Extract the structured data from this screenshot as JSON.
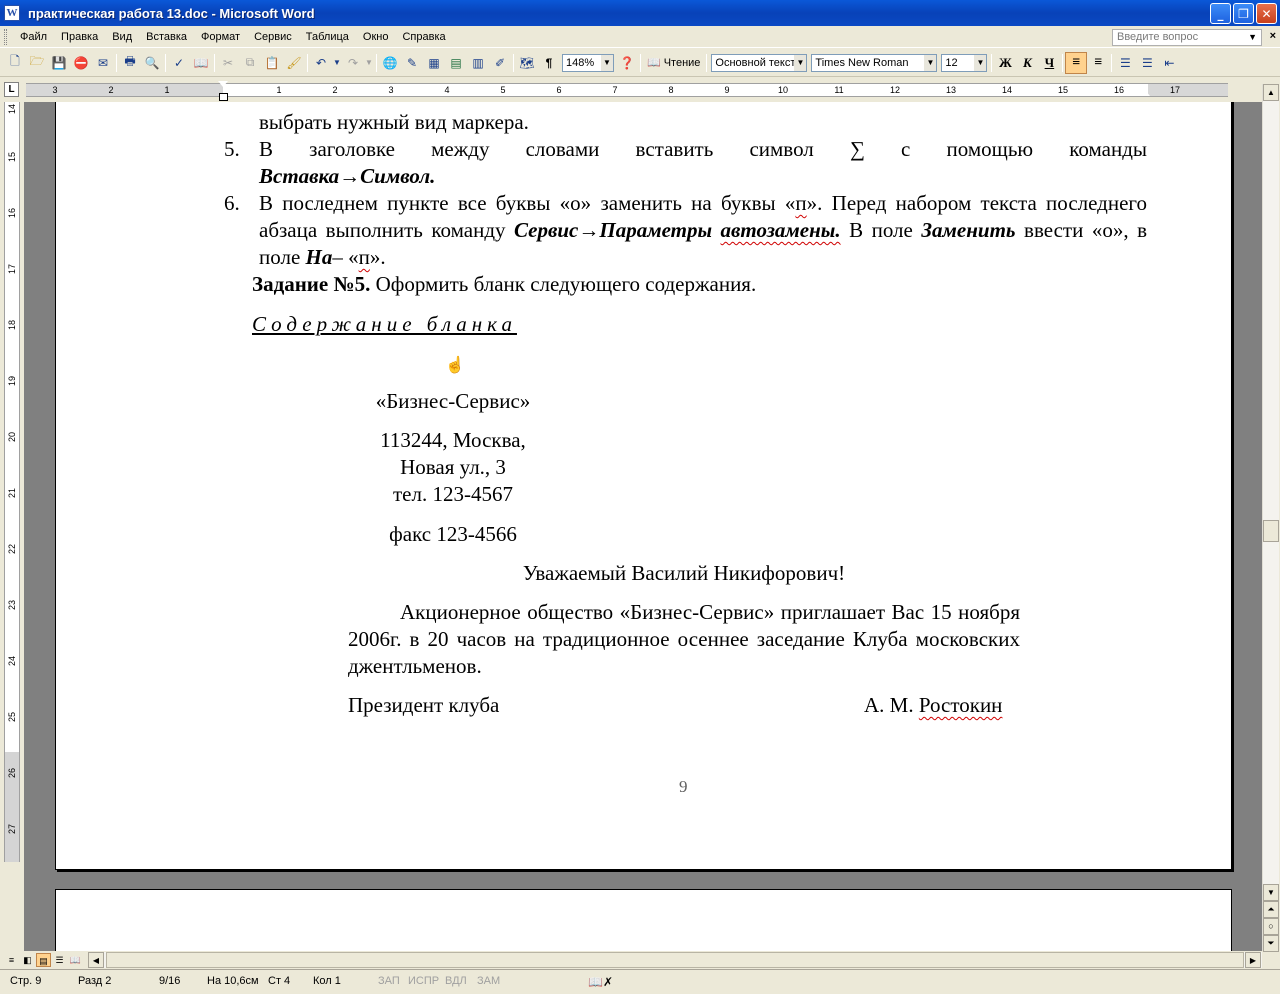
{
  "window": {
    "title": "практическая работа 13.doc - Microsoft Word",
    "app_icon": "W",
    "buttons": {
      "minimize": "_",
      "maximize": "❐",
      "close": "✕"
    }
  },
  "menu": {
    "items": [
      "Файл",
      "Правка",
      "Вид",
      "Вставка",
      "Формат",
      "Сервис",
      "Таблица",
      "Окно",
      "Справка"
    ],
    "ask_placeholder": "Введите вопрос",
    "close_doc": "×"
  },
  "toolbar": {
    "zoom": "148%",
    "reading_label": "Чтение",
    "style": "Основной текст",
    "font": "Times New Roman",
    "size": "12",
    "bold": "Ж",
    "italic": "К",
    "underline": "Ч",
    "pilcrow": "¶"
  },
  "ruler": {
    "corner": "L",
    "numbers": [
      "3",
      "2",
      "1",
      "1",
      "2",
      "3",
      "4",
      "5",
      "6",
      "7",
      "8",
      "9",
      "10",
      "11",
      "12",
      "13",
      "14",
      "15",
      "16",
      "17"
    ],
    "vnumbers": [
      "14",
      "15",
      "16",
      "17",
      "18",
      "19",
      "20",
      "21",
      "22",
      "23",
      "24",
      "25",
      "26",
      "27"
    ]
  },
  "document": {
    "line_top": "выбрать нужный вид маркера.",
    "item5_num": "5.",
    "item5_text_a": "В заголовке между словами вставить символ ∑ с помощью команды",
    "item5_cmd": "Вставка→Символ.",
    "item6_num": "6.",
    "item6_a": "В последнем пункте все буквы «о» заменить на буквы «",
    "item6_p1": "п",
    "item6_b": "». Перед набором текста последнего абзаца выполнить команду",
    "item6_cmd1": "Сервис→Параметры",
    "item6_cmd2": "автозамены.",
    "item6_c": "В поле",
    "item6_field1": "Заменить",
    "item6_d": "ввести «о», в поле",
    "item6_field2": "На",
    "item6_e": "– «",
    "item6_p2": "п",
    "item6_f": "».",
    "task5_label": "Задание №5.",
    "task5_text": "Оформить бланк следующего содержания.",
    "blank_heading": "Содержание бланка",
    "company": "«Бизнес-Сервис»",
    "address1": "113244, Москва,",
    "address2": "Новая ул., 3",
    "phone": "тел. 123-4567",
    "fax": "факс 123-4566",
    "greeting": "Уважаемый Василий Никифорович!",
    "body": "Акционерное общество «Бизнес-Сервис» приглашает Вас 15 ноября 2006г. в 20 часов на традиционное осеннее заседание Клуба московских джентльменов.",
    "sign_left": "Президент клуба",
    "sign_right_a": "А. М. ",
    "sign_right_b": "Ростокин",
    "page_number": "9"
  },
  "status": {
    "page": "Стр. 9",
    "section": "Разд 2",
    "pages": "9/16",
    "at": "На 10,6см",
    "line": "Ст 4",
    "col": "Кол 1",
    "rec": "ЗАП",
    "trk": "ИСПР",
    "ext": "ВДЛ",
    "ovr": "ЗАМ"
  }
}
